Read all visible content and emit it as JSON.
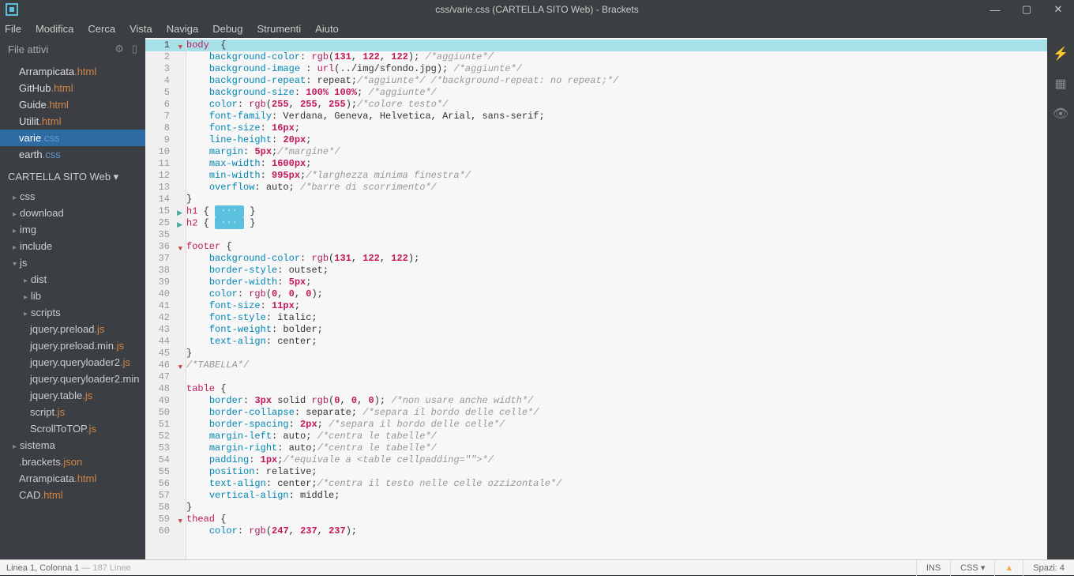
{
  "window": {
    "title": "css/varie.css (CARTELLA SITO Web) - Brackets"
  },
  "menu": [
    "File",
    "Modifica",
    "Cerca",
    "Vista",
    "Naviga",
    "Debug",
    "Strumenti",
    "Aiuto"
  ],
  "working_files": {
    "title": "File attivi",
    "items": [
      {
        "name": "Arrampicata",
        "ext": ".html",
        "kind": "html"
      },
      {
        "name": "GitHub",
        "ext": ".html",
        "kind": "html"
      },
      {
        "name": "Guide",
        "ext": ".html",
        "kind": "html"
      },
      {
        "name": "Utilit",
        "ext": ".html",
        "kind": "html"
      },
      {
        "name": "varie",
        "ext": ".css",
        "kind": "css",
        "selected": true
      },
      {
        "name": "earth",
        "ext": ".css",
        "kind": "css"
      }
    ]
  },
  "project": {
    "title": "CARTELLA SITO Web ▾",
    "tree": [
      {
        "label": "css",
        "type": "folder"
      },
      {
        "label": "download",
        "type": "folder"
      },
      {
        "label": "img",
        "type": "folder"
      },
      {
        "label": "include",
        "type": "folder"
      },
      {
        "label": "js",
        "type": "folder",
        "open": true
      },
      {
        "label": "dist",
        "type": "folder",
        "sub": true
      },
      {
        "label": "lib",
        "type": "folder",
        "sub": true
      },
      {
        "label": "scripts",
        "type": "folder",
        "sub": true
      },
      {
        "label": "jquery.preload",
        "ext": ".js",
        "type": "file",
        "deep": true
      },
      {
        "label": "jquery.preload.min",
        "ext": ".js",
        "type": "file",
        "deep": true
      },
      {
        "label": "jquery.queryloader2",
        "ext": ".js",
        "type": "file",
        "deep": true
      },
      {
        "label": "jquery.queryloader2.min",
        "ext": "",
        "type": "file",
        "deep": true
      },
      {
        "label": "jquery.table",
        "ext": ".js",
        "type": "file",
        "deep": true
      },
      {
        "label": "script",
        "ext": ".js",
        "type": "file",
        "deep": true
      },
      {
        "label": "ScrollToTOP",
        "ext": ".js",
        "type": "file",
        "deep": true
      },
      {
        "label": "sistema",
        "type": "folder"
      },
      {
        "label": ".brackets",
        "ext": ".json",
        "type": "file"
      },
      {
        "label": "Arrampicata",
        "ext": ".html",
        "type": "file"
      },
      {
        "label": "CAD",
        "ext": ".html",
        "type": "file"
      }
    ]
  },
  "editor": {
    "line_numbers": [
      "1",
      "2",
      "3",
      "4",
      "5",
      "6",
      "7",
      "8",
      "9",
      "10",
      "11",
      "12",
      "13",
      "14",
      "15",
      "25",
      "35",
      "36",
      "37",
      "38",
      "39",
      "40",
      "41",
      "42",
      "43",
      "44",
      "45",
      "46",
      "47",
      "48",
      "49",
      "50",
      "51",
      "52",
      "53",
      "54",
      "55",
      "56",
      "57",
      "58",
      "59",
      "60"
    ],
    "marks": {
      "0": "down",
      "14": "right",
      "15": "right",
      "17": "down",
      "27": "down",
      "40": "down"
    }
  },
  "status": {
    "left_a": "Linea 1, Colonna 1",
    "left_b": "— 187 Linee",
    "ins": "INS",
    "lang": "CSS ▾",
    "spaces": "Spazi: 4"
  }
}
